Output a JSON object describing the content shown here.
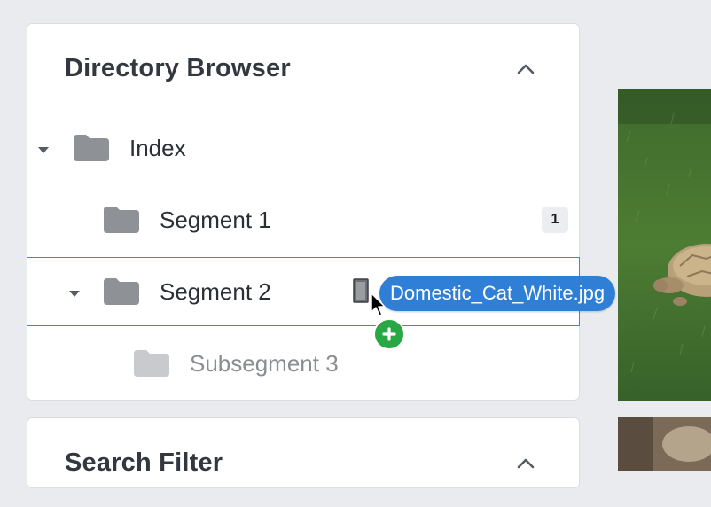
{
  "directory_browser": {
    "title": "Directory Browser",
    "collapse_icon": "chevron-up-icon",
    "items": [
      {
        "label": "Index",
        "expanded": true,
        "icon": "folder-icon"
      },
      {
        "label": "Segment 1",
        "icon": "folder-icon",
        "badge": "1"
      },
      {
        "label": "Segment 2",
        "expanded": true,
        "selected": true,
        "icon": "folder-icon"
      },
      {
        "label": "Subsegment 3",
        "icon": "folder-icon",
        "dimmed": true
      }
    ]
  },
  "drag": {
    "file_name": "Domestic_Cat_White.jpg",
    "file_icon": "file-icon",
    "cursor_icon": "arrow-cursor-icon",
    "add_icon": "plus-circle-icon"
  },
  "search_filter": {
    "title": "Search Filter",
    "collapse_icon": "chevron-up-icon"
  },
  "colors": {
    "selection_border": "#4a7fe0",
    "drag_chip": "#2f7fd6",
    "add_badge": "#27a844",
    "folder": "#8e9196",
    "folder_dim": "#c8cacd"
  }
}
